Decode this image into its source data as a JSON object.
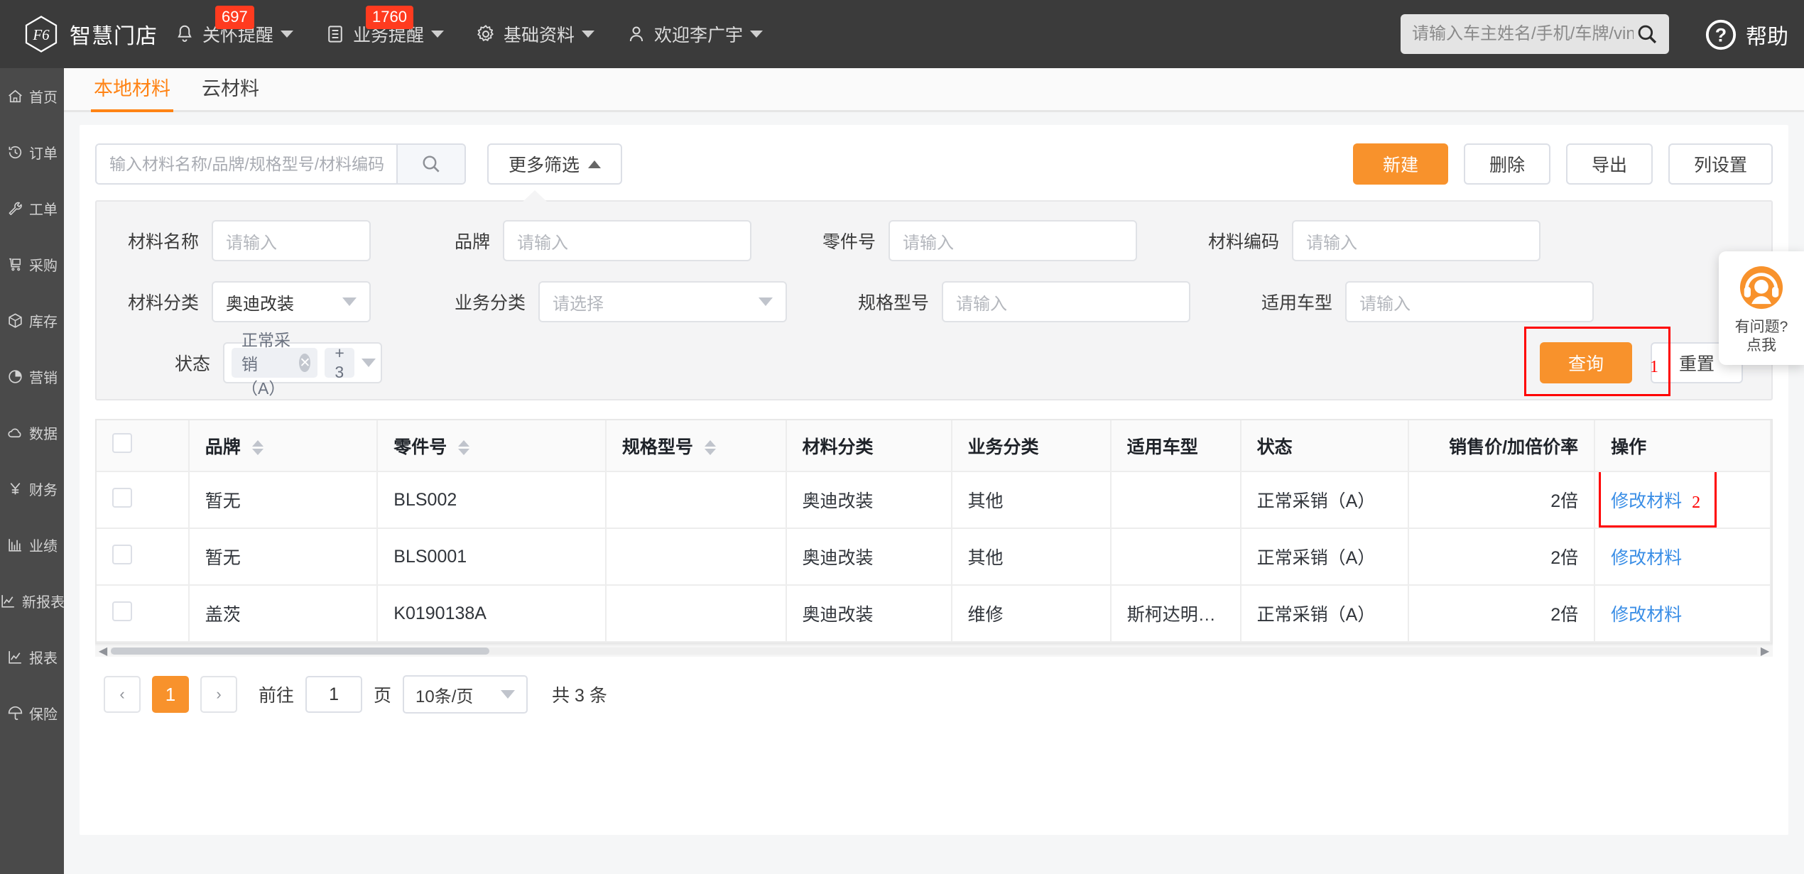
{
  "header": {
    "brand": "智慧门店",
    "nav": [
      {
        "label": "关怀提醒",
        "icon": "bell-icon",
        "badge": "697"
      },
      {
        "label": "业务提醒",
        "icon": "list-icon",
        "badge": "1760"
      },
      {
        "label": "基础资料",
        "icon": "gear-icon",
        "badge": ""
      },
      {
        "label": "欢迎李广宇",
        "icon": "user-icon",
        "badge": ""
      }
    ],
    "search_placeholder": "请输入车主姓名/手机/车牌/vin码",
    "search_value": "",
    "help_label": "帮助"
  },
  "sidebar": {
    "items": [
      {
        "label": "首页",
        "icon": "home-icon"
      },
      {
        "label": "订单",
        "icon": "history-icon"
      },
      {
        "label": "工单",
        "icon": "wrench-icon"
      },
      {
        "label": "采购",
        "icon": "cart-icon"
      },
      {
        "label": "库存",
        "icon": "box-icon"
      },
      {
        "label": "营销",
        "icon": "pie-icon"
      },
      {
        "label": "数据",
        "icon": "cloud-icon"
      },
      {
        "label": "财务",
        "icon": "yuan-icon"
      },
      {
        "label": "业绩",
        "icon": "bar-chart-icon"
      },
      {
        "label": "新报表",
        "icon": "line-chart-icon"
      },
      {
        "label": "报表",
        "icon": "line-chart-icon"
      },
      {
        "label": "保险",
        "icon": "umbrella-icon"
      }
    ]
  },
  "tabs": [
    {
      "label": "本地材料",
      "active": true
    },
    {
      "label": "云材料",
      "active": false
    }
  ],
  "toolbar": {
    "search_placeholder": "输入材料名称/品牌/规格型号/材料编码/零件号查询",
    "search_value": "",
    "more_filter_label": "更多筛选",
    "create_label": "新建",
    "delete_label": "删除",
    "export_label": "导出",
    "column_setting_label": "列设置"
  },
  "filters": {
    "row1": [
      {
        "label": "材料名称",
        "type": "input",
        "value": "",
        "placeholder": "请输入"
      },
      {
        "label": "品牌",
        "type": "input",
        "value": "",
        "placeholder": "请输入"
      },
      {
        "label": "零件号",
        "type": "input",
        "value": "",
        "placeholder": "请输入"
      },
      {
        "label": "材料编码",
        "type": "input",
        "value": "",
        "placeholder": "请输入"
      }
    ],
    "row2": [
      {
        "label": "材料分类",
        "type": "select",
        "value": "奥迪改装",
        "placeholder": ""
      },
      {
        "label": "业务分类",
        "type": "select",
        "value": "",
        "placeholder": "请选择"
      },
      {
        "label": "规格型号",
        "type": "input",
        "value": "",
        "placeholder": "请输入"
      },
      {
        "label": "适用车型",
        "type": "input",
        "value": "",
        "placeholder": "请输入"
      }
    ],
    "status": {
      "label": "状态",
      "tag": "正常采销（A）",
      "more": "+ 3"
    },
    "query_label": "查询",
    "reset_label": "重置"
  },
  "annotations": [
    {
      "number": "1",
      "target": "查询"
    },
    {
      "number": "2",
      "target": "修改材料"
    }
  ],
  "table": {
    "columns": [
      {
        "label": "",
        "sortable": false,
        "key": "check"
      },
      {
        "label": "品牌",
        "sortable": true,
        "key": "brand"
      },
      {
        "label": "零件号",
        "sortable": true,
        "key": "part_no"
      },
      {
        "label": "规格型号",
        "sortable": true,
        "key": "spec"
      },
      {
        "label": "材料分类",
        "sortable": false,
        "key": "mat_cat"
      },
      {
        "label": "业务分类",
        "sortable": false,
        "key": "biz_cat"
      },
      {
        "label": "适用车型",
        "sortable": false,
        "key": "vehicle"
      },
      {
        "label": "状态",
        "sortable": false,
        "key": "status"
      },
      {
        "label": "销售价/加倍价率",
        "sortable": false,
        "key": "price"
      },
      {
        "label": "操作",
        "sortable": false,
        "key": "action"
      }
    ],
    "rows": [
      {
        "brand": "暂无",
        "part_no": "BLS002",
        "spec": "",
        "mat_cat": "奥迪改装",
        "biz_cat": "其他",
        "vehicle": "",
        "status": "正常采销（A）",
        "price": "2倍",
        "action": "修改材料"
      },
      {
        "brand": "暂无",
        "part_no": "BLS0001",
        "spec": "",
        "mat_cat": "奥迪改装",
        "biz_cat": "其他",
        "vehicle": "",
        "status": "正常采销（A）",
        "price": "2倍",
        "action": "修改材料"
      },
      {
        "brand": "盖茨",
        "part_no": "K0190138A",
        "spec": "",
        "mat_cat": "奥迪改装",
        "biz_cat": "维修",
        "vehicle": "斯柯达明…",
        "status": "正常采销（A）",
        "price": "2倍",
        "action": "修改材料"
      }
    ]
  },
  "pagination": {
    "prev": "‹",
    "next": "›",
    "current_page": "1",
    "goto_label": "前往",
    "goto_value": "1",
    "page_unit": "页",
    "page_size": "10条/页",
    "total": "共 3 条"
  },
  "float_help": {
    "line1": "有问题?",
    "line2": "点我"
  },
  "colors": {
    "accent": "#f8922c",
    "link": "#3a8ee6",
    "badge": "#ff3b1f",
    "annotation": "#ff0000",
    "header_bg": "#3b3b3b",
    "sidebar_bg": "#4a4a4a"
  }
}
